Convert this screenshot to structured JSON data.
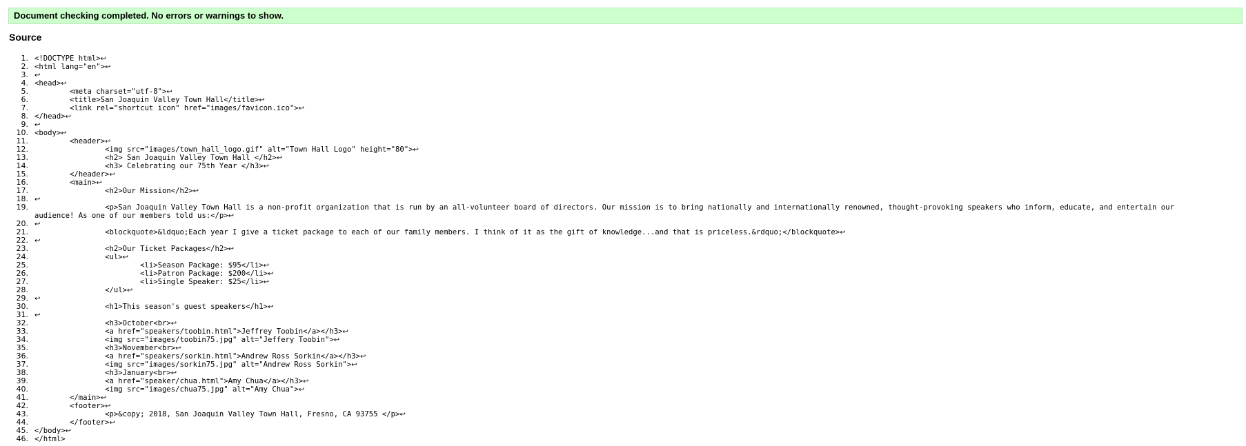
{
  "status": {
    "message": "Document checking completed. No errors or warnings to show."
  },
  "source": {
    "heading": "Source",
    "line_end_glyph": "↩",
    "lines": [
      {
        "n": "1.",
        "text": "<!DOCTYPE html>",
        "lf": true
      },
      {
        "n": "2.",
        "text": "<html lang=\"en\">",
        "lf": true
      },
      {
        "n": "3.",
        "text": "",
        "lf": true
      },
      {
        "n": "4.",
        "text": "<head>",
        "lf": true
      },
      {
        "n": "5.",
        "text": "\t<meta charset=\"utf-8\">",
        "lf": true
      },
      {
        "n": "6.",
        "text": "\t<title>San Joaquin Valley Town Hall</title>",
        "lf": true
      },
      {
        "n": "7.",
        "text": "\t<link rel=\"shortcut icon\" href=\"images/favicon.ico\">",
        "lf": true
      },
      {
        "n": "8.",
        "text": "</head>",
        "lf": true
      },
      {
        "n": "9.",
        "text": "",
        "lf": true
      },
      {
        "n": "10.",
        "text": "<body>",
        "lf": true
      },
      {
        "n": "11.",
        "text": "\t<header>",
        "lf": true
      },
      {
        "n": "12.",
        "text": "\t\t<img src=\"images/town_hall_logo.gif\" alt=\"Town Hall Logo\" height=\"80\">",
        "lf": true
      },
      {
        "n": "13.",
        "text": "\t\t<h2> San Joaquin Valley Town Hall </h2>",
        "lf": true
      },
      {
        "n": "14.",
        "text": "\t\t<h3> Celebrating our 75th Year </h3>",
        "lf": true
      },
      {
        "n": "15.",
        "text": "\t</header>",
        "lf": true
      },
      {
        "n": "16.",
        "text": "\t<main>",
        "lf": true
      },
      {
        "n": "17.",
        "text": "\t\t<h2>Our Mission</h2>",
        "lf": true
      },
      {
        "n": "18.",
        "text": "",
        "lf": true
      },
      {
        "n": "19.",
        "text": "\t\t<p>San Joaquin Valley Town Hall is a non-profit organization that is run by an all-volunteer board of directors. Our mission is to bring nationally and internationally renowned, thought-provoking speakers who inform, educate, and entertain our audience! As one of our members told us:</p>",
        "lf": true,
        "wrap": true
      },
      {
        "n": "20.",
        "text": "",
        "lf": true
      },
      {
        "n": "21.",
        "text": "\t\t<blockquote>&ldquo;Each year I give a ticket package to each of our family members. I think of it as the gift of knowledge...and that is priceless.&rdquo;</blockquote>",
        "lf": true
      },
      {
        "n": "22.",
        "text": "",
        "lf": true
      },
      {
        "n": "23.",
        "text": "\t\t<h2>Our Ticket Packages</h2>",
        "lf": true
      },
      {
        "n": "24.",
        "text": "\t\t<ul>",
        "lf": true
      },
      {
        "n": "25.",
        "text": "\t\t\t<li>Season Package: $95</li>",
        "lf": true
      },
      {
        "n": "26.",
        "text": "\t\t\t<li>Patron Package: $200</li>",
        "lf": true
      },
      {
        "n": "27.",
        "text": "\t\t\t<li>Single Speaker: $25</li>",
        "lf": true
      },
      {
        "n": "28.",
        "text": "\t\t</ul>",
        "lf": true
      },
      {
        "n": "29.",
        "text": "",
        "lf": true
      },
      {
        "n": "30.",
        "text": "\t\t<h1>This season's guest speakers</h1>",
        "lf": true
      },
      {
        "n": "31.",
        "text": "",
        "lf": true
      },
      {
        "n": "32.",
        "text": "\t\t<h3>October<br>",
        "lf": true
      },
      {
        "n": "33.",
        "text": "\t\t<a href=\"speakers/toobin.html\">Jeffrey Toobin</a></h3>",
        "lf": true
      },
      {
        "n": "34.",
        "text": "\t\t<img src=\"images/toobin75.jpg\" alt=\"Jeffery Toobin\">",
        "lf": true
      },
      {
        "n": "35.",
        "text": "\t\t<h3>November<br>",
        "lf": true
      },
      {
        "n": "36.",
        "text": "\t\t<a href=\"speakers/sorkin.html\">Andrew Ross Sorkin</a></h3>",
        "lf": true
      },
      {
        "n": "37.",
        "text": "\t\t<img src=\"images/sorkin75.jpg\" alt=\"Andrew Ross Sorkin\">",
        "lf": true
      },
      {
        "n": "38.",
        "text": "\t\t<h3>January<br>",
        "lf": true
      },
      {
        "n": "39.",
        "text": "\t\t<a href=\"speaker/chua.html\">Amy Chua</a></h3>",
        "lf": true
      },
      {
        "n": "40.",
        "text": "\t\t<img src=\"images/chua75.jpg\" alt=\"Amy Chua\">",
        "lf": true
      },
      {
        "n": "41.",
        "text": "\t</main>",
        "lf": true
      },
      {
        "n": "42.",
        "text": "\t<footer>",
        "lf": true
      },
      {
        "n": "43.",
        "text": "\t\t<p>&copy; 2018, San Joaquin Valley Town Hall, Fresno, CA 93755 </p>",
        "lf": true
      },
      {
        "n": "44.",
        "text": "\t</footer>",
        "lf": true
      },
      {
        "n": "45.",
        "text": "</body>",
        "lf": true
      },
      {
        "n": "46.",
        "text": "</html>",
        "lf": false
      }
    ]
  }
}
